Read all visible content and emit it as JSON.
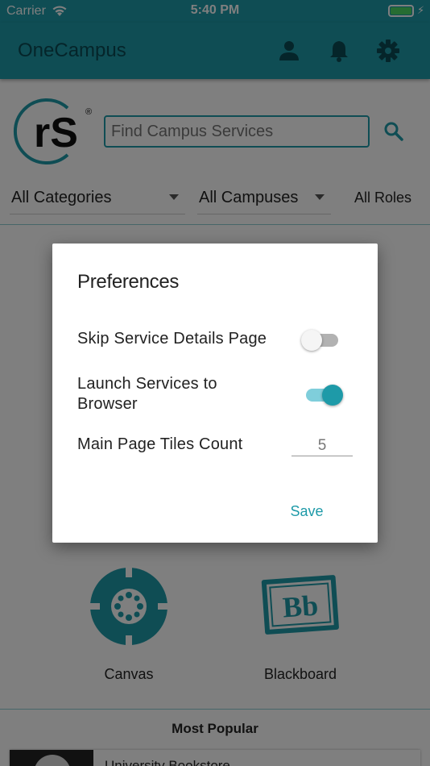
{
  "status_bar": {
    "carrier": "Carrier",
    "time": "5:40 PM"
  },
  "app_bar": {
    "title": "OneCampus",
    "icons": [
      "person-icon",
      "bell-icon",
      "gear-icon"
    ]
  },
  "logo": {
    "text": "rS",
    "trademark": "®"
  },
  "search": {
    "placeholder": "Find Campus Services",
    "value": ""
  },
  "filters": {
    "categories": "All Categories",
    "campuses": "All Campuses",
    "roles": "All Roles"
  },
  "tiles": [
    {
      "label": "Canvas",
      "icon": "canvas-logo-icon"
    },
    {
      "label": "Blackboard",
      "icon": "blackboard-logo-icon",
      "logo_text": "Bb"
    }
  ],
  "most_popular": {
    "heading": "Most Popular",
    "first_item": "University Bookstore"
  },
  "dialog": {
    "title": "Preferences",
    "skip_details": {
      "label": "Skip Service Details Page",
      "on": false
    },
    "launch_browser": {
      "label": "Launch Services to Browser",
      "on": true
    },
    "tiles_count": {
      "label": "Main Page Tiles Count",
      "value": "5"
    },
    "save_label": "Save"
  },
  "colors": {
    "brand": "#1e9aa8",
    "brand_dark": "#0b4a55",
    "battery": "#4cd964"
  }
}
